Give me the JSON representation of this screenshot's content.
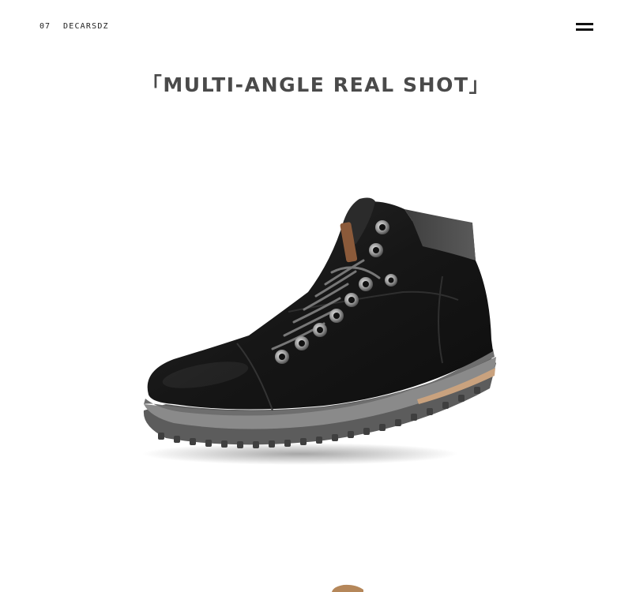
{
  "header": {
    "page_number": "07",
    "brand": "DECARSDZ",
    "menu_icon": "hamburger-menu-icon"
  },
  "section": {
    "title": "「MULTI-ANGLE REAL SHOT」"
  },
  "images": {
    "main": "black-leather-ankle-boot",
    "next_partial": "brown-boot-partial"
  },
  "colors": {
    "background": "#ffffff",
    "text": "#4a4a4a",
    "boot_leather": "#1c1c1c",
    "collar": "#4b4b4b",
    "sole": "#6e6e6e",
    "heel_tan": "#c9a27e",
    "next_image_tan": "#b5875a"
  }
}
